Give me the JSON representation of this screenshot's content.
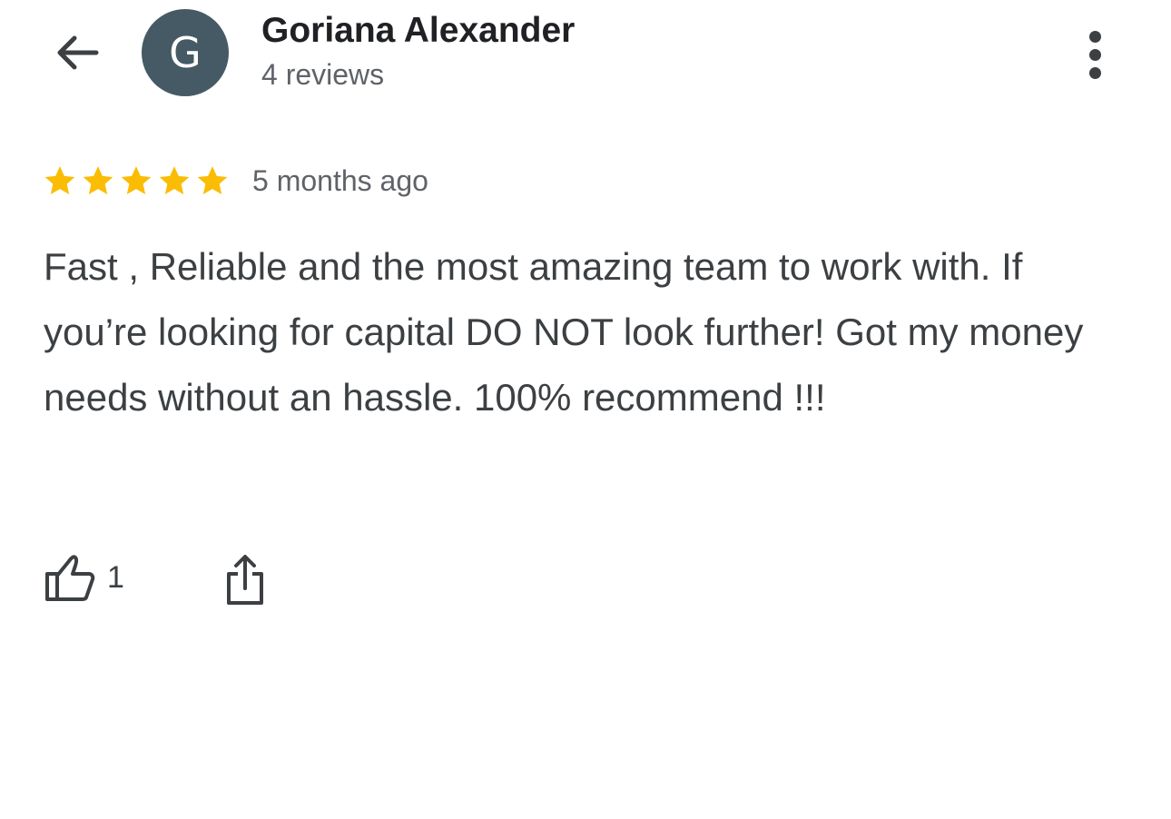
{
  "header": {
    "back_icon": "arrow-left-icon",
    "avatar_initial": "G",
    "avatar_color": "#455a64",
    "reviewer_name": "Goriana Alexander",
    "review_count": "4 reviews",
    "more_icon": "more-vertical-icon"
  },
  "review": {
    "rating": 5,
    "rating_max": 5,
    "star_color": "#fbbc04",
    "date": "5 months ago",
    "text": "Fast , Reliable and the most amazing team to work with. If you’re looking for capital DO NOT look further! Got my money needs without an hassle. 100% recommend !!!"
  },
  "actions": {
    "like_icon": "thumbs-up-icon",
    "like_count": "1",
    "share_icon": "share-icon"
  }
}
